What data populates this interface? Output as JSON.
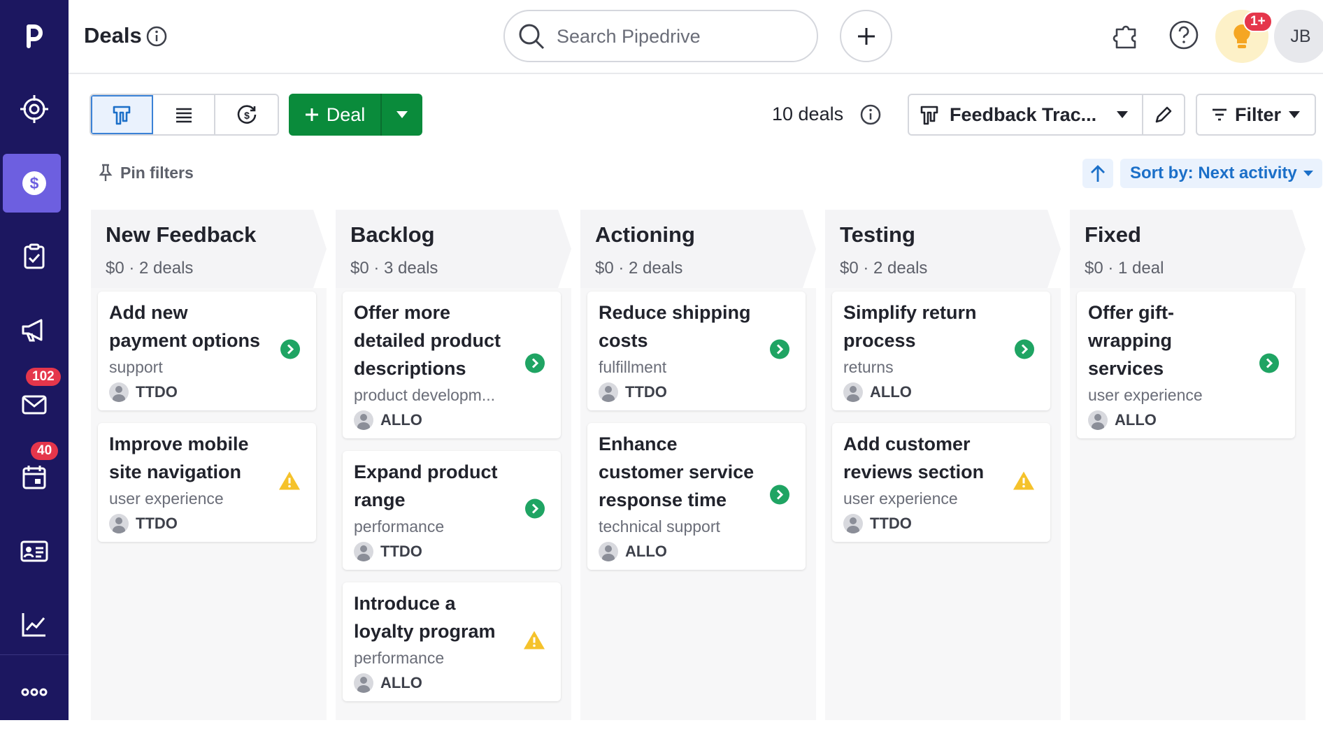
{
  "header": {
    "title": "Deals",
    "search_placeholder": "Search Pipedrive",
    "notification_badge": "1+",
    "user_initials": "JB"
  },
  "sidebar": {
    "items": [
      {
        "name": "logo",
        "icon": "pipedrive-logo"
      },
      {
        "name": "leads",
        "icon": "target-icon"
      },
      {
        "name": "deals",
        "icon": "dollar-icon",
        "active": true
      },
      {
        "name": "activities",
        "icon": "checklist-icon"
      },
      {
        "name": "campaigns",
        "icon": "megaphone-icon"
      },
      {
        "name": "mail",
        "icon": "mail-icon",
        "badge": "102"
      },
      {
        "name": "calendar",
        "icon": "calendar-icon",
        "badge": "40"
      },
      {
        "name": "contacts",
        "icon": "contact-card-icon"
      },
      {
        "name": "insights",
        "icon": "chart-icon"
      },
      {
        "name": "more",
        "icon": "more-icon"
      }
    ]
  },
  "toolbar": {
    "deal_button_label": "Deal",
    "deal_count": "10 deals",
    "pipeline_name": "Feedback Trac...",
    "filter_label": "Filter",
    "pin_filters_label": "Pin filters",
    "sort_label": "Sort by: Next activity"
  },
  "colors": {
    "sidebar_bg": "#1c1760",
    "sidebar_active": "#6d5fe0",
    "primary_green": "#0a8b3b",
    "status_green": "#1fa463",
    "warning_yellow": "#f5c22b",
    "link_blue": "#1b6fc8"
  },
  "columns": [
    {
      "name": "New Feedback",
      "summary": "$0 · 2 deals",
      "cards": [
        {
          "title": "Add new payment options",
          "label": "support",
          "owner": "TTDO",
          "status": "next-activity"
        },
        {
          "title": "Improve mobile site navigation",
          "label": "user experience",
          "owner": "TTDO",
          "status": "warning"
        }
      ]
    },
    {
      "name": "Backlog",
      "summary": "$0 · 3 deals",
      "cards": [
        {
          "title": "Offer more detailed product descriptions",
          "label": "product developm...",
          "owner": "ALLO",
          "status": "next-activity"
        },
        {
          "title": "Expand product range",
          "label": "performance",
          "owner": "TTDO",
          "status": "next-activity"
        },
        {
          "title": "Introduce a loyalty program",
          "label": "performance",
          "owner": "ALLO",
          "status": "warning"
        }
      ]
    },
    {
      "name": "Actioning",
      "summary": "$0 · 2 deals",
      "cards": [
        {
          "title": "Reduce shipping costs",
          "label": "fulfillment",
          "owner": "TTDO",
          "status": "next-activity"
        },
        {
          "title": "Enhance customer service response time",
          "label": "technical support",
          "owner": "ALLO",
          "status": "next-activity"
        }
      ]
    },
    {
      "name": "Testing",
      "summary": "$0 · 2 deals",
      "cards": [
        {
          "title": "Simplify return process",
          "label": "returns",
          "owner": "ALLO",
          "status": "next-activity"
        },
        {
          "title": "Add customer reviews section",
          "label": "user experience",
          "owner": "TTDO",
          "status": "warning"
        }
      ]
    },
    {
      "name": "Fixed",
      "summary": "$0 · 1 deal",
      "cards": [
        {
          "title": "Offer gift-wrapping services",
          "label": "user experience",
          "owner": "ALLO",
          "status": "next-activity"
        }
      ]
    }
  ]
}
